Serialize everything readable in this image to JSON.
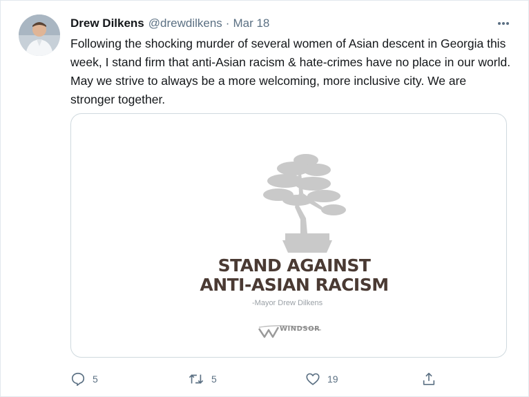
{
  "tweet": {
    "author_name": "Drew Dilkens",
    "handle": "@drewdilkens",
    "separator": "·",
    "date": "Mar 18",
    "text": "Following the shocking murder of several women of Asian descent in Georgia this week, I stand firm that anti-Asian racism & hate-crimes have no place in our world. May we strive to always be a more welcoming, more inclusive city. We are stronger together."
  },
  "media": {
    "headline_line1": "STAND AGAINST",
    "headline_line2": "ANTI-ASIAN RACISM",
    "byline": "-Mayor Drew Dilkens",
    "logo_text": "WINDSOR",
    "headline_color": "#4a3a33",
    "tree_color": "#c9c9c9"
  },
  "actions": {
    "reply_count": "5",
    "retweet_count": "5",
    "like_count": "19",
    "icon_color": "#5b7083"
  },
  "icons": {
    "more": "more-dots-icon",
    "reply": "reply-bubble-icon",
    "retweet": "retweet-arrows-icon",
    "like": "heart-icon",
    "share": "share-upload-icon"
  }
}
